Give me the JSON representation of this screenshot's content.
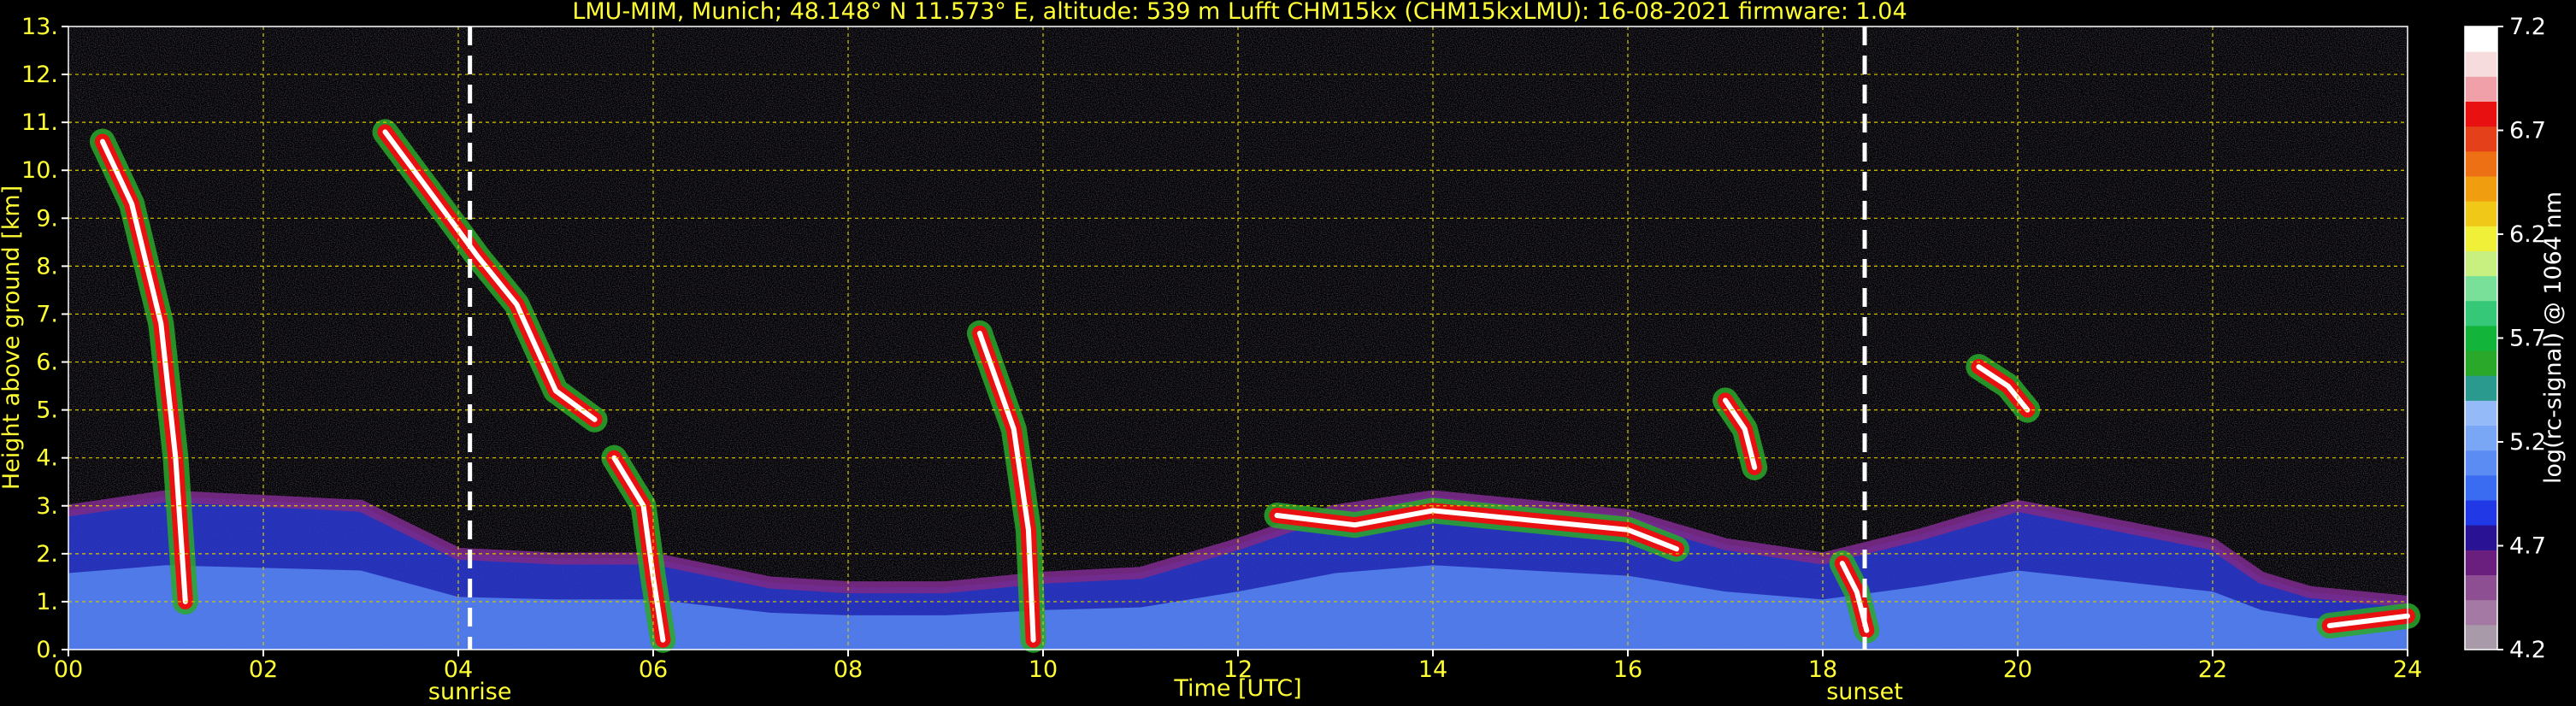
{
  "chart_data": {
    "type": "heatmap",
    "title": "LMU-MIM, Munich; 48.148° N 11.573° E, altitude: 539 m    Lufft CHM15kx (CHM15kxLMU): 16-08-2021    firmware: 1.04",
    "xlabel": "Time [UTC]",
    "ylabel": "Height above ground [km]",
    "xlim": [
      0,
      24
    ],
    "ylim": [
      0,
      13
    ],
    "x_ticks": [
      "00",
      "02",
      "04",
      "06",
      "08",
      "10",
      "12",
      "14",
      "16",
      "18",
      "20",
      "22",
      "24"
    ],
    "y_ticks": [
      "0.",
      "1.",
      "2.",
      "3.",
      "4.",
      "5.",
      "6.",
      "7.",
      "8.",
      "9.",
      "10.",
      "11.",
      "12.",
      "13."
    ],
    "grid": true,
    "markers": [
      {
        "label": "sunrise",
        "time": 4.12
      },
      {
        "label": "sunset",
        "time": 18.43
      }
    ],
    "colorbar": {
      "label": "log(rc-signal) @ 1064 nm",
      "range": [
        4.2,
        7.2
      ],
      "ticks": [
        "4.2",
        "4.7",
        "5.2",
        "5.7",
        "6.2",
        "6.7",
        "7.2"
      ],
      "colors": [
        "#a89aa8",
        "#a47aa4",
        "#8e4e92",
        "#6a1e7e",
        "#2a1294",
        "#2038e6",
        "#3a6cf2",
        "#5a8cf4",
        "#7aa6f6",
        "#94baf8",
        "#2a9a8e",
        "#2aa82a",
        "#12b43a",
        "#34c878",
        "#78e098",
        "#c8f080",
        "#f0f038",
        "#f0c818",
        "#f09e10",
        "#ee7014",
        "#e4401a",
        "#e81010",
        "#f0a0a8",
        "#f6dcdc",
        "#ffffff"
      ]
    },
    "layers": [
      {
        "name": "boundary layer",
        "points": [
          [
            0,
            2.9
          ],
          [
            1,
            3.2
          ],
          [
            2,
            3.1
          ],
          [
            3,
            3.0
          ],
          [
            4,
            2.0
          ],
          [
            5,
            1.9
          ],
          [
            6,
            1.9
          ],
          [
            7.2,
            1.4
          ],
          [
            8,
            1.3
          ],
          [
            9,
            1.3
          ],
          [
            10,
            1.5
          ],
          [
            11,
            1.6
          ],
          [
            12,
            2.2
          ],
          [
            13,
            2.9
          ],
          [
            14,
            3.2
          ],
          [
            15,
            3.0
          ],
          [
            16,
            2.8
          ],
          [
            17,
            2.2
          ],
          [
            18,
            1.9
          ],
          [
            19,
            2.4
          ],
          [
            20,
            3.0
          ],
          [
            21,
            2.6
          ],
          [
            22,
            2.2
          ],
          [
            22.5,
            1.5
          ],
          [
            23,
            1.2
          ],
          [
            24,
            1.0
          ]
        ]
      },
      {
        "name": "cloud",
        "points": [
          [
            0.35,
            10.6
          ],
          [
            0.65,
            9.3
          ],
          [
            0.95,
            6.8
          ],
          [
            1.1,
            4.0
          ],
          [
            1.2,
            1.0
          ]
        ]
      },
      {
        "name": "cloud",
        "points": [
          [
            3.25,
            10.8
          ],
          [
            3.8,
            9.3
          ],
          [
            4.2,
            8.2
          ],
          [
            4.6,
            7.2
          ],
          [
            5.0,
            5.4
          ],
          [
            5.4,
            4.8
          ]
        ]
      },
      {
        "name": "cloud",
        "points": [
          [
            5.6,
            4.0
          ],
          [
            5.9,
            3.0
          ],
          [
            6.0,
            1.5
          ],
          [
            6.1,
            0.2
          ]
        ]
      },
      {
        "name": "cloud",
        "points": [
          [
            9.35,
            6.6
          ],
          [
            9.7,
            4.6
          ],
          [
            9.85,
            2.5
          ],
          [
            9.9,
            0.2
          ]
        ]
      },
      {
        "name": "cloud",
        "points": [
          [
            12.4,
            2.8
          ],
          [
            13.2,
            2.6
          ],
          [
            14.0,
            2.9
          ],
          [
            15.0,
            2.7
          ],
          [
            16.0,
            2.5
          ],
          [
            16.5,
            2.1
          ]
        ]
      },
      {
        "name": "cloud",
        "points": [
          [
            17.0,
            5.2
          ],
          [
            17.2,
            4.6
          ],
          [
            17.3,
            3.8
          ]
        ]
      },
      {
        "name": "cloud",
        "points": [
          [
            19.6,
            5.9
          ],
          [
            19.9,
            5.5
          ],
          [
            20.1,
            5.0
          ]
        ]
      },
      {
        "name": "cloud",
        "points": [
          [
            18.2,
            1.8
          ],
          [
            18.35,
            1.2
          ],
          [
            18.45,
            0.4
          ]
        ]
      },
      {
        "name": "cloud",
        "points": [
          [
            23.2,
            0.5
          ],
          [
            23.6,
            0.6
          ],
          [
            24,
            0.7
          ]
        ]
      }
    ]
  }
}
